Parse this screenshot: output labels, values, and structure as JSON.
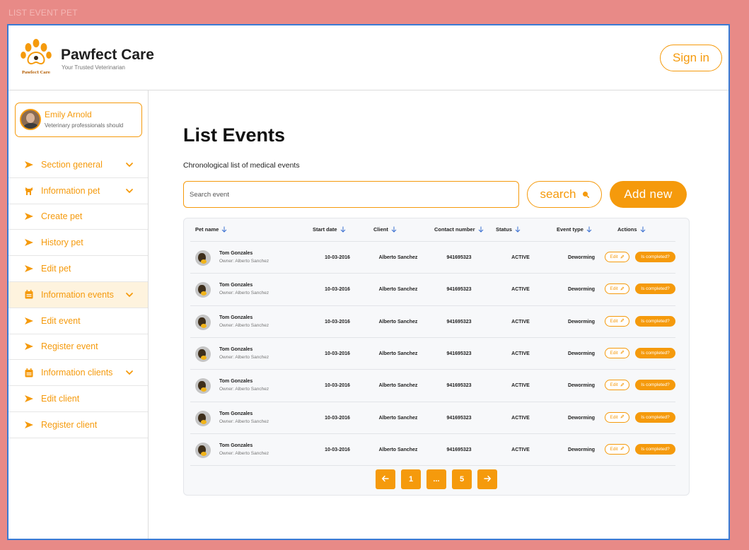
{
  "canvas_label": "LIST EVENT PET",
  "colors": {
    "accent": "#f59a0c",
    "frame_border": "#3a7bd5",
    "background": "#e88a87"
  },
  "header": {
    "brand_title": "Pawfect Care",
    "brand_subtitle": "Your Trusted Veterinarian",
    "logo_caption": "Pawfect Care",
    "signin_label": "Sign in"
  },
  "sidebar": {
    "profile": {
      "name": "Emily Arnold",
      "role": "Veterinary professionals should"
    },
    "items": [
      {
        "label": "Section general",
        "icon": "arrow-right-icon",
        "dropdown": true
      },
      {
        "label": "Information pet",
        "icon": "dog-icon",
        "dropdown": true
      },
      {
        "label": "Create pet",
        "icon": "arrow-right-icon",
        "dropdown": false
      },
      {
        "label": "History pet",
        "icon": "arrow-right-icon",
        "dropdown": false
      },
      {
        "label": "Edit pet",
        "icon": "arrow-right-icon",
        "dropdown": false
      },
      {
        "label": "Information events",
        "icon": "calendar-icon",
        "dropdown": true
      },
      {
        "label": "Edit event",
        "icon": "arrow-right-icon",
        "dropdown": false
      },
      {
        "label": "Register event",
        "icon": "arrow-right-icon",
        "dropdown": false
      },
      {
        "label": "Information clients",
        "icon": "calendar-icon",
        "dropdown": true
      },
      {
        "label": "Edit client",
        "icon": "arrow-right-icon",
        "dropdown": false
      },
      {
        "label": "Register client",
        "icon": "arrow-right-icon",
        "dropdown": false
      }
    ],
    "active_item": "Information events"
  },
  "main": {
    "title": "List Events",
    "subtitle": "Chronological list of medical events",
    "search_placeholder": "Search event",
    "search_button": "search",
    "add_button": "Add  new"
  },
  "table": {
    "columns": [
      "Pet name",
      "Start date",
      "Client",
      "Contact number",
      "Status",
      "Event type",
      "Actions"
    ],
    "rows": [
      {
        "pet": "Tom Gonzales",
        "owner": "Owner: Alberto Sanchez",
        "start_date": "10-03-2016",
        "client": "Alberto Sanchez",
        "contact": "941695323",
        "status": "ACTIVE",
        "event_type": "Deworming",
        "edit": "Edit",
        "complete": "Is completed?"
      },
      {
        "pet": "Tom Gonzales",
        "owner": "Owner: Alberto Sanchez",
        "start_date": "10-03-2016",
        "client": "Alberto Sanchez",
        "contact": "941695323",
        "status": "ACTIVE",
        "event_type": "Deworming",
        "edit": "Edit",
        "complete": "Is completed?"
      },
      {
        "pet": "Tom Gonzales",
        "owner": "Owner: Alberto Sanchez",
        "start_date": "10-03-2016",
        "client": "Alberto Sanchez",
        "contact": "941695323",
        "status": "ACTIVE",
        "event_type": "Deworming",
        "edit": "Edit",
        "complete": "Is completed?"
      },
      {
        "pet": "Tom Gonzales",
        "owner": "Owner: Alberto Sanchez",
        "start_date": "10-03-2016",
        "client": "Alberto Sanchez",
        "contact": "941695323",
        "status": "ACTIVE",
        "event_type": "Deworming",
        "edit": "Edit",
        "complete": "Is completed?"
      },
      {
        "pet": "Tom Gonzales",
        "owner": "Owner: Alberto Sanchez",
        "start_date": "10-03-2016",
        "client": "Alberto Sanchez",
        "contact": "941695323",
        "status": "ACTIVE",
        "event_type": "Deworming",
        "edit": "Edit",
        "complete": "Is completed?"
      },
      {
        "pet": "Tom Gonzales",
        "owner": "Owner: Alberto Sanchez",
        "start_date": "10-03-2016",
        "client": "Alberto Sanchez",
        "contact": "941695323",
        "status": "ACTIVE",
        "event_type": "Deworming",
        "edit": "Edit",
        "complete": "Is completed?"
      },
      {
        "pet": "Tom Gonzales",
        "owner": "Owner: Alberto Sanchez",
        "start_date": "10-03-2016",
        "client": "Alberto Sanchez",
        "contact": "941695323",
        "status": "ACTIVE",
        "event_type": "Deworming",
        "edit": "Edit",
        "complete": "Is completed?"
      }
    ]
  },
  "pagination": {
    "prev_icon": "arrow-left-icon",
    "pages": [
      "1",
      "...",
      "5"
    ],
    "next_icon": "arrow-right-icon"
  }
}
